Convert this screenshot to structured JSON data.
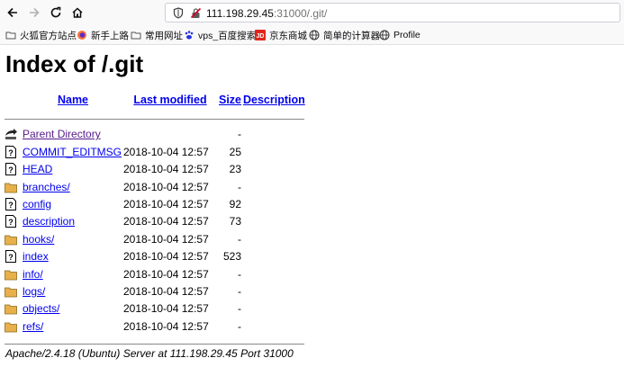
{
  "browser": {
    "url_host": "111.198.29.45",
    "url_rest": ":31000/.git/",
    "bookmarks": [
      {
        "label": "火狐官方站点",
        "icon": "folder-icon"
      },
      {
        "label": "新手上路",
        "icon": "firefox-icon"
      },
      {
        "label": "常用网址",
        "icon": "folder-icon"
      },
      {
        "label": "vps_百度搜索",
        "icon": "baidu-paw-icon"
      },
      {
        "label": "京东商城",
        "icon": "jd-icon"
      },
      {
        "label": "简单的计算器",
        "icon": "globe-icon"
      },
      {
        "label": "Profile",
        "icon": "globe-icon"
      }
    ]
  },
  "page": {
    "title": "Index of /.git",
    "columns": {
      "name": "Name",
      "last_modified": "Last modified",
      "size": "Size",
      "description": "Description"
    },
    "parent": {
      "label": "Parent Directory",
      "size": "-"
    },
    "rows": [
      {
        "name": "COMMIT_EDITMSG",
        "modified": "2018-10-04 12:57",
        "size": "25",
        "type": "file"
      },
      {
        "name": "HEAD",
        "modified": "2018-10-04 12:57",
        "size": "23",
        "type": "file"
      },
      {
        "name": "branches/",
        "modified": "2018-10-04 12:57",
        "size": "-",
        "type": "folder"
      },
      {
        "name": "config",
        "modified": "2018-10-04 12:57",
        "size": "92",
        "type": "file"
      },
      {
        "name": "description",
        "modified": "2018-10-04 12:57",
        "size": "73",
        "type": "file"
      },
      {
        "name": "hooks/",
        "modified": "2018-10-04 12:57",
        "size": "-",
        "type": "folder"
      },
      {
        "name": "index",
        "modified": "2018-10-04 12:57",
        "size": "523",
        "type": "file"
      },
      {
        "name": "info/",
        "modified": "2018-10-04 12:57",
        "size": "-",
        "type": "folder"
      },
      {
        "name": "logs/",
        "modified": "2018-10-04 12:57",
        "size": "-",
        "type": "folder"
      },
      {
        "name": "objects/",
        "modified": "2018-10-04 12:57",
        "size": "-",
        "type": "folder"
      },
      {
        "name": "refs/",
        "modified": "2018-10-04 12:57",
        "size": "-",
        "type": "folder"
      }
    ],
    "footer": "Apache/2.4.18 (Ubuntu) Server at 111.198.29.45 Port 31000"
  },
  "colors": {
    "link": "#0000ee",
    "visited": "#551a8b",
    "folder": "#e8b04a"
  }
}
